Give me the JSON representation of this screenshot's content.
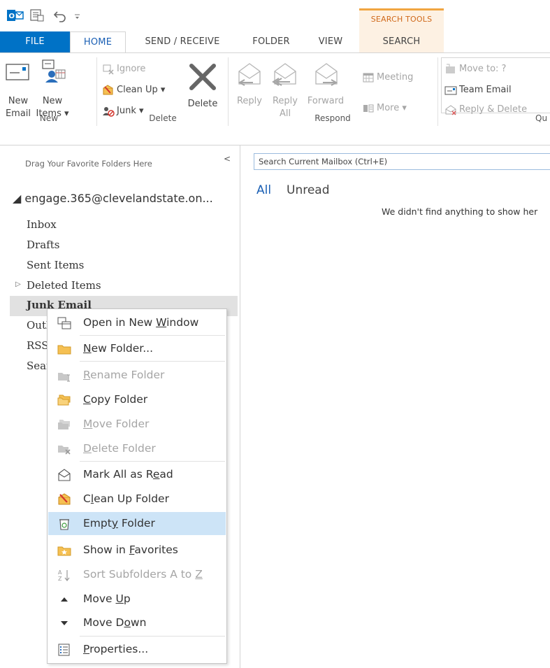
{
  "title_bar": {
    "contextual_group": "SEARCH TOOLS"
  },
  "tabs": {
    "file": "FILE",
    "home": "HOME",
    "send_receive": "SEND / RECEIVE",
    "folder": "FOLDER",
    "view": "VIEW",
    "search": "SEARCH"
  },
  "ribbon": {
    "new_group": {
      "label": "New",
      "new_email": [
        "New",
        "Email"
      ],
      "new_items": [
        "New",
        "Items ▾"
      ]
    },
    "delete_group": {
      "label": "Delete",
      "ignore": "Ignore",
      "clean_up": "Clean Up ▾",
      "junk": "Junk ▾",
      "delete": "Delete"
    },
    "respond_group": {
      "label": "Respond",
      "reply": "Reply",
      "reply_all": [
        "Reply",
        "All"
      ],
      "forward": "Forward",
      "meeting": "Meeting",
      "more": "More ▾"
    },
    "quick_steps_group": {
      "label": "Qu",
      "move_to": "Move to: ?",
      "team_email": "Team Email",
      "reply_delete": "Reply & Delete"
    }
  },
  "folder_pane": {
    "favorites_hint": "Drag Your Favorite Folders Here",
    "collapse_glyph": "<",
    "account": "◢ engage.365@clevelandstate.on...",
    "folders": {
      "inbox": "Inbox",
      "drafts": "Drafts",
      "sent": "Sent Items",
      "deleted": "Deleted Items",
      "deleted_expander": "▷",
      "junk": "Junk Email",
      "outbox": "Outb",
      "rss": "RSS",
      "search": "Sear"
    }
  },
  "main": {
    "search_placeholder": "Search Current Mailbox (Ctrl+E)",
    "filter_all": "All",
    "filter_unread": "Unread",
    "empty_message": "We didn't find anything to show her"
  },
  "context_menu": {
    "open_new_window": {
      "pre": "Open in New ",
      "u": "W",
      "post": "indow"
    },
    "new_folder": {
      "pre": "",
      "u": "N",
      "post": "ew Folder..."
    },
    "rename_folder": {
      "pre": "",
      "u": "R",
      "post": "ename Folder"
    },
    "copy_folder": {
      "pre": "",
      "u": "C",
      "post": "opy Folder"
    },
    "move_folder": {
      "pre": "",
      "u": "M",
      "post": "ove Folder"
    },
    "delete_folder": {
      "pre": "",
      "u": "D",
      "post": "elete Folder"
    },
    "mark_all_read": {
      "pre": "Mark All as R",
      "u": "e",
      "post": "ad"
    },
    "clean_up_folder": {
      "pre": "C",
      "u": "l",
      "post": "ean Up Folder"
    },
    "empty_folder": {
      "pre": "Empt",
      "u": "y",
      "post": " Folder"
    },
    "show_in_favorites": {
      "pre": "Show in ",
      "u": "F",
      "post": "avorites"
    },
    "sort_subfolders": {
      "pre": "Sort Subfolders A to ",
      "u": "Z",
      "post": ""
    },
    "move_up": {
      "pre": "Move ",
      "u": "U",
      "post": "p"
    },
    "move_down": {
      "pre": "Move D",
      "u": "o",
      "post": "wn"
    },
    "properties": {
      "pre": "",
      "u": "P",
      "post": "roperties..."
    }
  },
  "colors": {
    "accent_blue": "#0072c6",
    "search_tab_orange": "#f0a541",
    "selection_blue": "#cde4f7"
  }
}
